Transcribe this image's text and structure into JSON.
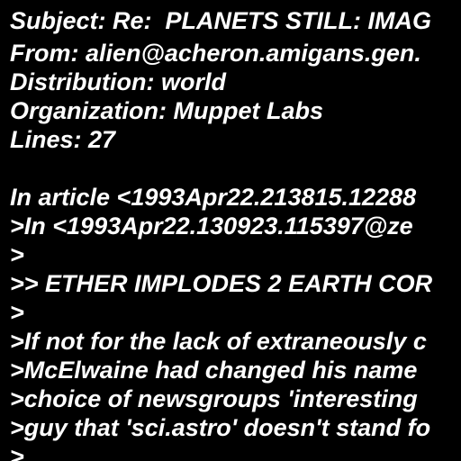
{
  "colors": {
    "background": "#000000",
    "text": "#ffffff"
  },
  "message": {
    "lines": [
      "Subject: Re:  PLANETS STILL: IMAG",
      "From: alien@acheron.amigans.gen.",
      "Distribution: world",
      "Organization: Muppet Labs",
      "Lines: 27",
      "",
      "In article <1993Apr22.213815.12288",
      ">In <1993Apr22.130923.115397@ze",
      ">",
      ">> ETHER IMPLODES 2 EARTH COR",
      ">",
      ">If not for the lack of extraneously c",
      ">McElwaine had changed his name",
      ">choice of newsgroups 'interesting",
      ">guy that 'sci.astro' doesn't stand fo",
      ">"
    ]
  }
}
